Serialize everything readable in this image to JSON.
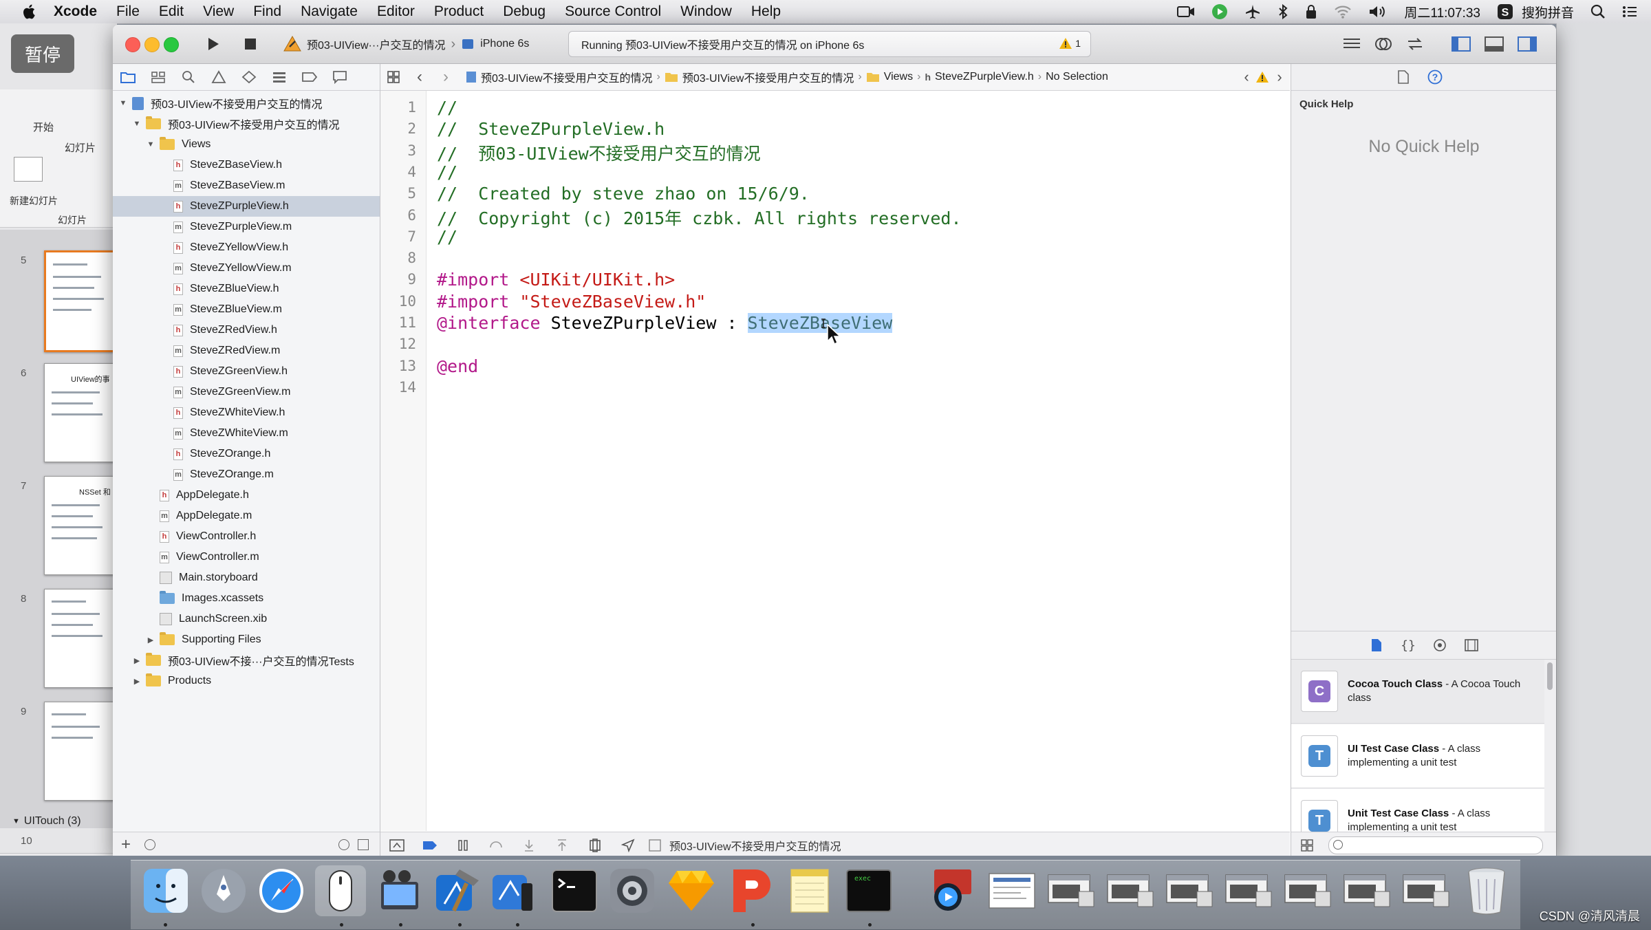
{
  "menubar": {
    "app": "Xcode",
    "menus": [
      "File",
      "Edit",
      "View",
      "Find",
      "Navigate",
      "Editor",
      "Product",
      "Debug",
      "Source Control",
      "Window",
      "Help"
    ],
    "clock": "周二11:07:33",
    "input_method": "搜狗拼音"
  },
  "background_app": {
    "pause_label": "暂停",
    "tab_start": "开始",
    "tab_slides": "幻灯片",
    "new_slide": "新建幻灯片",
    "slides_label": "幻灯片",
    "slide_numbers": [
      "5",
      "6",
      "7",
      "8",
      "9",
      "10"
    ],
    "group_label": "UITouch (3)",
    "thumb_title_1": "UIView的事",
    "thumb_title_2": "NSSet 和"
  },
  "toolbar": {
    "scheme": "预03-UIView···户交互的情况",
    "device": "iPhone 6s",
    "activity": "Running 预03-UIView不接受用户交互的情况 on iPhone 6s",
    "warning_count": "1"
  },
  "navigator": {
    "project": "预03-UIView不接受用户交互的情况",
    "group": "预03-UIView不接受用户交互的情况",
    "views_folder": "Views",
    "files": [
      {
        "name": "SteveZBaseView.h",
        "type": "h"
      },
      {
        "name": "SteveZBaseView.m",
        "type": "m"
      },
      {
        "name": "SteveZPurpleView.h",
        "type": "h"
      },
      {
        "name": "SteveZPurpleView.m",
        "type": "m"
      },
      {
        "name": "SteveZYellowView.h",
        "type": "h"
      },
      {
        "name": "SteveZYellowView.m",
        "type": "m"
      },
      {
        "name": "SteveZBlueView.h",
        "type": "h"
      },
      {
        "name": "SteveZBlueView.m",
        "type": "m"
      },
      {
        "name": "SteveZRedView.h",
        "type": "h"
      },
      {
        "name": "SteveZRedView.m",
        "type": "m"
      },
      {
        "name": "SteveZGreenView.h",
        "type": "h"
      },
      {
        "name": "SteveZGreenView.m",
        "type": "m"
      },
      {
        "name": "SteveZWhiteView.h",
        "type": "h"
      },
      {
        "name": "SteveZWhiteView.m",
        "type": "m"
      },
      {
        "name": "SteveZOrange.h",
        "type": "h"
      },
      {
        "name": "SteveZOrange.m",
        "type": "m"
      }
    ],
    "other_files": [
      {
        "name": "AppDelegate.h",
        "type": "h"
      },
      {
        "name": "AppDelegate.m",
        "type": "m"
      },
      {
        "name": "ViewController.h",
        "type": "h"
      },
      {
        "name": "ViewController.m",
        "type": "m"
      },
      {
        "name": "Main.storyboard",
        "type": "sb"
      },
      {
        "name": "Images.xcassets",
        "type": "assets"
      },
      {
        "name": "LaunchScreen.xib",
        "type": "sb"
      }
    ],
    "supporting_files": "Supporting Files",
    "tests_folder": "预03-UIView不接···户交互的情况Tests",
    "products": "Products"
  },
  "jumpbar": {
    "crumbs": [
      "预03-UIView不接受用户交互的情况",
      "预03-UIView不接受用户交互的情况",
      "Views",
      "SteveZPurpleView.h",
      "No Selection"
    ]
  },
  "editor": {
    "lines": [
      {
        "n": "1"
      },
      {
        "n": "2"
      },
      {
        "n": "3"
      },
      {
        "n": "4"
      },
      {
        "n": "5"
      },
      {
        "n": "6"
      },
      {
        "n": "7"
      },
      {
        "n": "8"
      },
      {
        "n": "9"
      },
      {
        "n": "10"
      },
      {
        "n": "11"
      },
      {
        "n": "12"
      },
      {
        "n": "13"
      },
      {
        "n": "14"
      }
    ],
    "code": {
      "l1": "//",
      "l2": "//  SteveZPurpleView.h",
      "l3": "//  预03-UIView不接受用户交互的情况",
      "l4": "//",
      "l5": "//  Created by steve zhao on 15/6/9.",
      "l6": "//  Copyright (c) 2015年 czbk. All rights reserved.",
      "l7": "//",
      "l9_kw": "#import ",
      "l9_str": "<UIKit/UIKit.h>",
      "l10_kw": "#import ",
      "l10_str": "\"SteveZBaseView.h\"",
      "l11_kw": "@interface",
      "l11_mid": " SteveZPurpleView : ",
      "l11_sel": "SteveZBaseView",
      "l13_kw": "@end"
    }
  },
  "debugbar": {
    "target": "预03-UIView不接受用户交互的情况"
  },
  "utilities": {
    "quick_help_title": "Quick Help",
    "quick_help_empty": "No Quick Help",
    "library": [
      {
        "icon": "C",
        "title": "Cocoa Touch Class",
        "desc": " - A Cocoa Touch class",
        "color": "#8e6fc7"
      },
      {
        "icon": "T",
        "title": "UI Test Case Class",
        "desc": " - A class implementing a unit test",
        "color": "#4e8fd1"
      },
      {
        "icon": "T",
        "title": "Unit Test Case Class",
        "desc": " - A class implementing a unit test",
        "color": "#4e8fd1"
      }
    ]
  },
  "dock": {
    "watermark": "CSDN @清风清晨",
    "terminal_text": "exec"
  }
}
